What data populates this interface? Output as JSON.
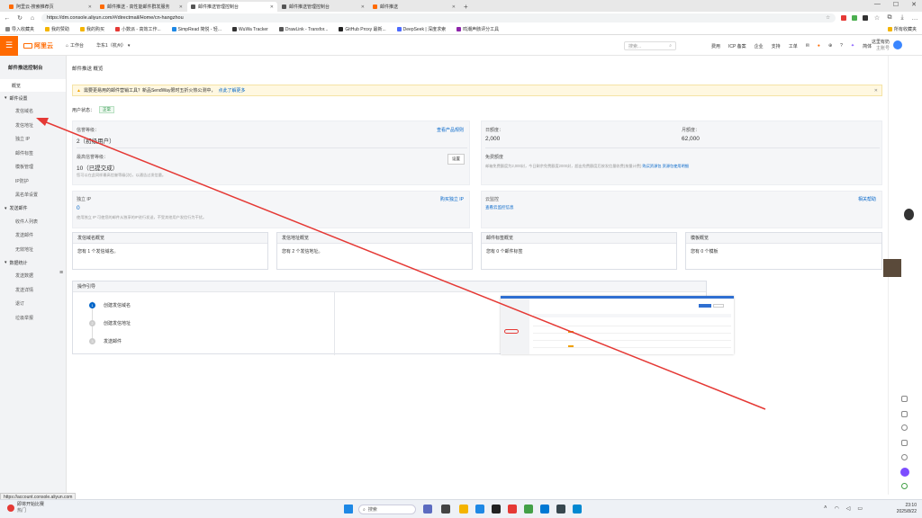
{
  "browser": {
    "tabs": [
      {
        "label": "阿里云-搜索推荐页",
        "color": "#ff6a00",
        "active": false
      },
      {
        "label": "邮件推送 - 高性能邮件群发服务",
        "color": "#ff6a00",
        "active": false
      },
      {
        "label": "邮件推送管理控制台",
        "color": "#555555",
        "active": true
      },
      {
        "label": "邮件推送管理控制台",
        "color": "#555555",
        "active": false
      },
      {
        "label": "邮件推送",
        "color": "#ff6a00",
        "active": false
      }
    ],
    "url": "https://dm.console.aliyun.com/#/directmail/Home/cn-hangzhou",
    "bookmarks": [
      "导入收藏夹",
      "我的赞助",
      "我的购买",
      "小数派 - 高效工作...",
      "SimpRead 简悦 - 轻...",
      "WuWa Tracker",
      "DrawLink - Transfor...",
      "GitHub Proxy 最新...",
      "DeepSeek | 深度求索",
      "鸣潮声骸评分工具"
    ],
    "other_bookmarks": "所有收藏夹"
  },
  "header": {
    "logo": "阿里云",
    "workbench": "工作台",
    "region": "华东1（杭州）",
    "search_placeholder": "搜索...",
    "links": [
      "费用",
      "ICP 备案",
      "企业",
      "支持",
      "工单"
    ],
    "lang": "简体",
    "user_name": "这里有奶",
    "user_sub": "主账号"
  },
  "sidebar": {
    "title": "邮件推送控制台",
    "overview": "概览",
    "groups": [
      {
        "label": "邮件设置",
        "items": [
          "发信域名",
          "发信地址",
          "独立 IP",
          "邮件标签",
          "模板管理",
          "IP防护",
          "黑名单设置"
        ]
      },
      {
        "label": "发送邮件",
        "items": [
          "收件人列表",
          "发送邮件",
          "无效地址"
        ]
      },
      {
        "label": "数据统计",
        "items": [
          "发送数据",
          "发送详情",
          "退订",
          "垃圾举报"
        ]
      }
    ]
  },
  "main": {
    "breadcrumb": "邮件推送 概览",
    "alert": "需要更易用的邮件营销工具？新品SendWay限时五折火热公测中，",
    "alert_link": "点此了解更多",
    "status_label": "用户状态：",
    "status_badge": "正常",
    "credit_label": "信誉等级：",
    "credit_value": "2（初级用户）",
    "credit_link": "查看产品规则",
    "max_credit_label": "最高信誉等级：",
    "max_credit_value": "10（已提交成）",
    "max_credit_note": "您可以在此同样最高信誉等级(次)，以通告过发信量。",
    "settings_button": "设置",
    "daily_label": "日额度：",
    "daily_value": "2,000",
    "monthly_label": "月额度：",
    "monthly_value": "62,000",
    "free_label": "免费额度",
    "free_note": "邮箱免费额度为2,000封，今日剩余免费额度2000封，超出免费额度后按发信量收费(按量计费)",
    "free_link1": "购买资源包",
    "free_link2": "资源包使用明细",
    "ip_label": "独立 IP",
    "ip_value": "0",
    "ip_link": "购买独立 IP",
    "ip_note": "使用独立 IP 可使您的邮件从独享的IP进行发送，不受其他用户发信行为干扰。",
    "monitor_label": "云监控",
    "monitor_link": "查看云监控信息",
    "help_link": "相关帮助",
    "cards": [
      {
        "title": "发信域名概览",
        "body": "您有 1 个发信域名。"
      },
      {
        "title": "发信地址概览",
        "body": "您有 2 个发信地址。"
      },
      {
        "title": "邮件标签概览",
        "body": "您有 0 个邮件标签"
      },
      {
        "title": "模板概览",
        "body": "您有 0 个模板"
      }
    ],
    "guide_title": "操作引导",
    "steps": [
      "创建发信域名",
      "创建发信地址",
      "发送邮件"
    ]
  },
  "status_url": "https://account.console.aliyun.com",
  "taskbar": {
    "weather_title": "即将开始比赛",
    "weather_sub": "热门",
    "search": "搜索",
    "time": "23:10",
    "date": "2025/8/22"
  },
  "accent_color": "#ff6a00",
  "link_color": "#0064c8",
  "annotation_color": "#e53935"
}
